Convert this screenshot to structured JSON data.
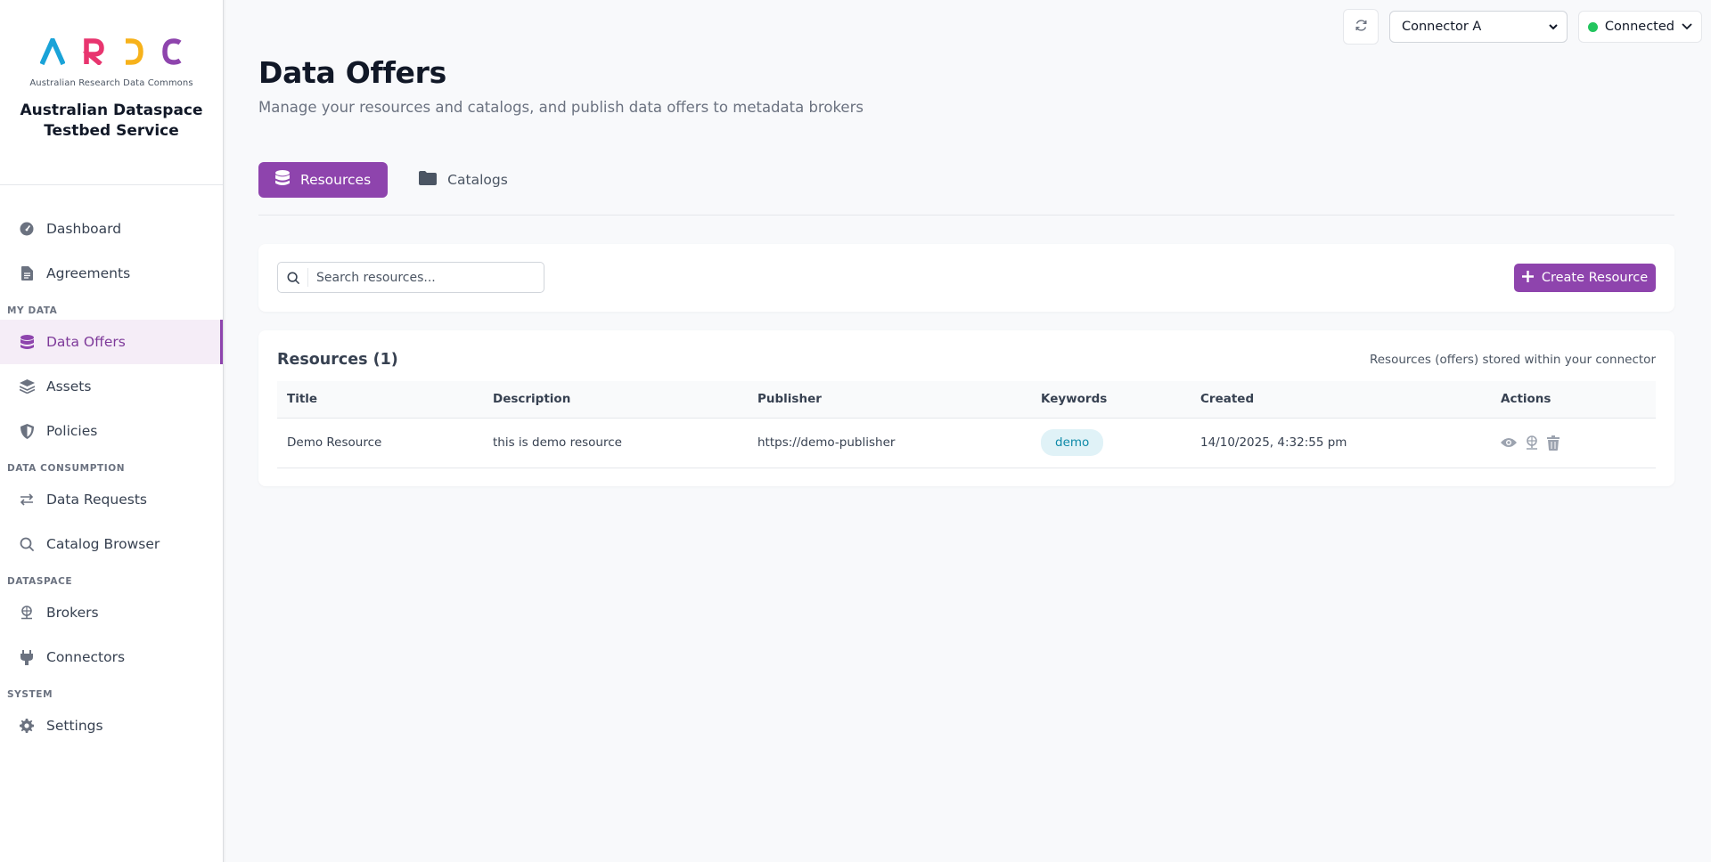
{
  "brand": {
    "logo_letters": [
      "A",
      "R",
      "D",
      "C"
    ],
    "logo_subtitle": "Australian Research Data Commons",
    "title_line1": "Australian Dataspace",
    "title_line2": "Testbed Service",
    "colors": {
      "a": "#1aa3d8",
      "r": "#e8356f",
      "d": "#f7b21b",
      "c": "#8e44ad"
    }
  },
  "sidebar": {
    "items_top": [
      {
        "label": "Dashboard",
        "icon": "gauge-icon"
      },
      {
        "label": "Agreements",
        "icon": "document-icon"
      }
    ],
    "sections": [
      {
        "title": "MY DATA",
        "items": [
          {
            "label": "Data Offers",
            "icon": "database-icon",
            "active": true
          },
          {
            "label": "Assets",
            "icon": "layers-icon"
          },
          {
            "label": "Policies",
            "icon": "shield-icon"
          }
        ]
      },
      {
        "title": "DATA CONSUMPTION",
        "items": [
          {
            "label": "Data Requests",
            "icon": "arrows-exchange-icon"
          },
          {
            "label": "Catalog Browser",
            "icon": "search-icon"
          }
        ]
      },
      {
        "title": "DATASPACE",
        "items": [
          {
            "label": "Brokers",
            "icon": "broker-icon"
          },
          {
            "label": "Connectors",
            "icon": "plug-icon"
          }
        ]
      },
      {
        "title": "SYSTEM",
        "items": [
          {
            "label": "Settings",
            "icon": "gear-icon"
          }
        ]
      }
    ]
  },
  "topbar": {
    "connector": "Connector A",
    "status": "Connected",
    "status_color": "#22c55e"
  },
  "page": {
    "title": "Data Offers",
    "subtitle": "Manage your resources and catalogs, and publish data offers to metadata brokers"
  },
  "tabs": [
    {
      "label": "Resources",
      "active": true
    },
    {
      "label": "Catalogs",
      "active": false
    }
  ],
  "toolbar": {
    "search_placeholder": "Search resources...",
    "create_label": "Create Resource"
  },
  "resources": {
    "title": "Resources (1)",
    "hint": "Resources (offers) stored within your connector",
    "columns": [
      "Title",
      "Description",
      "Publisher",
      "Keywords",
      "Created",
      "Actions"
    ],
    "rows": [
      {
        "title": "Demo Resource",
        "description": "this is demo resource",
        "publisher": "https://demo-publisher",
        "keyword": "demo",
        "created": "14/10/2025, 4:32:55 pm"
      }
    ]
  },
  "accent_color": "#8e44ad"
}
